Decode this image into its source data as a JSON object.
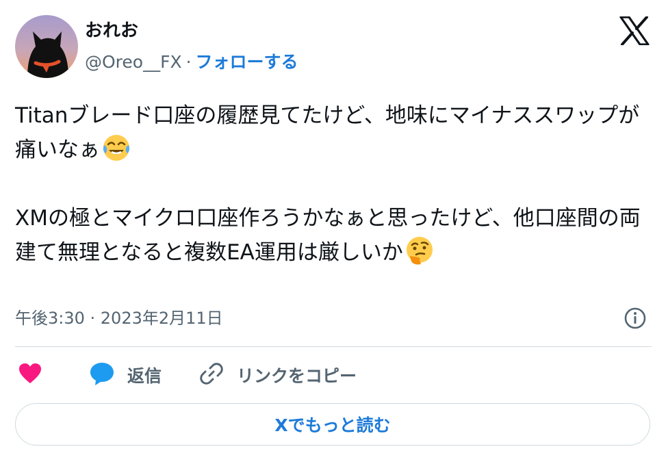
{
  "author": {
    "display_name": "おれお",
    "handle": "@Oreo__FX",
    "separator": "·",
    "follow_label": "フォローする"
  },
  "tweet": {
    "paragraph_1": "Titanブレード口座の履歴見てたけど、地味にマイナススワップが痛いなぁ",
    "paragraph_1_emoji": "face-with-tears-of-joy",
    "paragraph_2": "XMの極とマイクロ口座作ろうかなぁと思ったけど、他口座間の両建て無理となると複数EA運用は厳しいか",
    "paragraph_2_emoji": "thinking-face"
  },
  "meta": {
    "timestamp": "午後3:30 · 2023年2月11日"
  },
  "actions": {
    "like_icon": "heart-icon",
    "reply_label": "返信",
    "copy_link_label": "リンクをコピー"
  },
  "read_more_label": "Xでもっと読む",
  "colors": {
    "accent": "#1d7bd8",
    "heart": "#f91880",
    "secondary_text": "#536471",
    "divider": "#cfd9de",
    "reply_icon": "#1d9bf0"
  }
}
